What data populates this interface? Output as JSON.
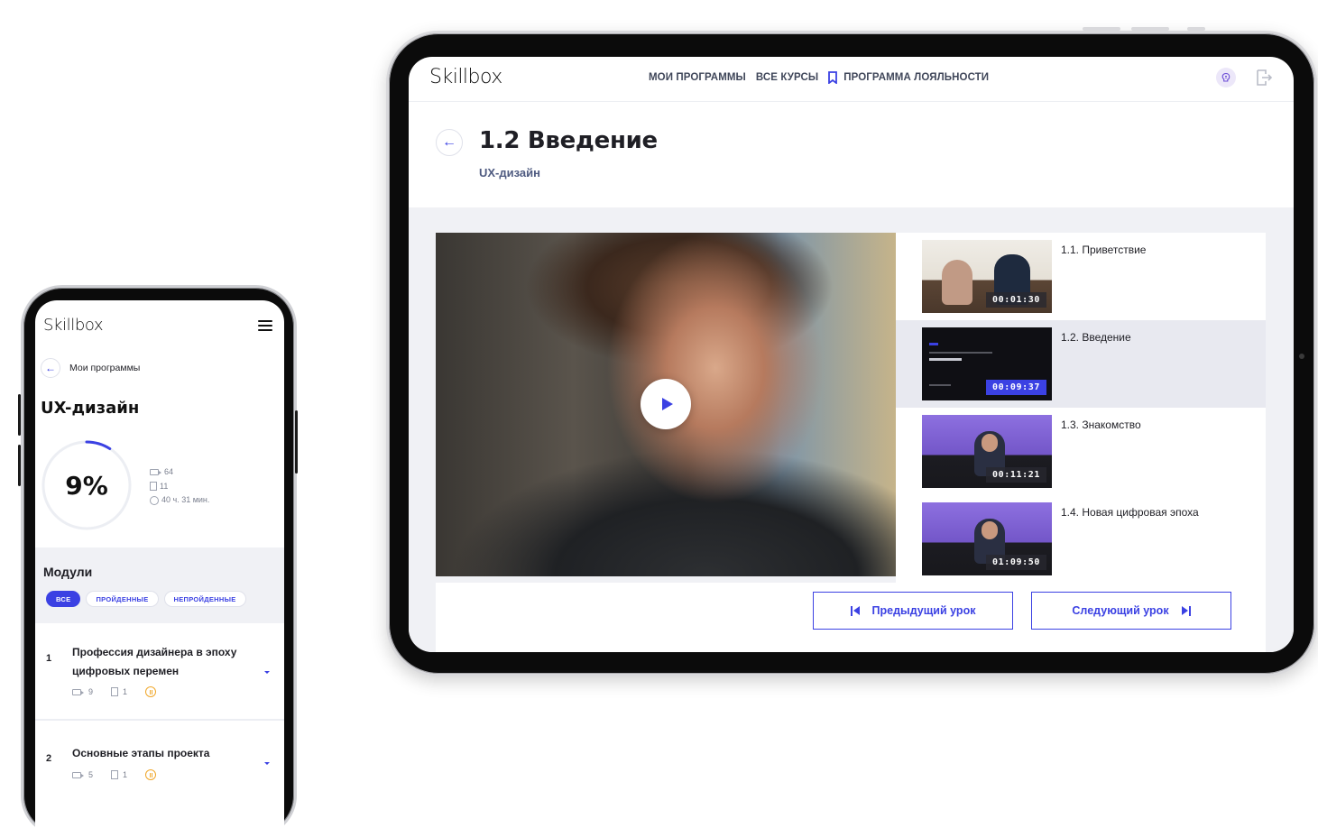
{
  "tablet": {
    "logo": "Skillbox",
    "nav": {
      "my_programs": "МОИ ПРОГРАММЫ",
      "all_courses": "ВСЕ КУРСЫ",
      "loyalty": "ПРОГРАММА ЛОЯЛЬНОСТИ"
    },
    "lesson": {
      "title": "1.2 Введение",
      "course": "UX-дизайн"
    },
    "playlist": [
      {
        "title": "1.1. Приветствие",
        "duration": "00:01:30",
        "active": false
      },
      {
        "title": "1.2. Введение",
        "duration": "00:09:37",
        "active": true
      },
      {
        "title": "1.3. Знакомство",
        "duration": "00:11:21",
        "active": false
      },
      {
        "title": "1.4. Новая цифровая эпоха",
        "duration": "01:09:50",
        "active": false
      }
    ],
    "buttons": {
      "prev": "Предыдущий урок",
      "next": "Следующий урок"
    },
    "colors": {
      "accent": "#3b41e3",
      "active_row": "#e8e9f0",
      "section_bg": "#f0f1f5"
    }
  },
  "phone": {
    "logo": "Skillbox",
    "back_label": "Мои программы",
    "course_title": "UX-дизайн",
    "progress": {
      "percent_label": "9%",
      "value": 0.09
    },
    "stats": {
      "videos": "64",
      "docs": "11",
      "time": "40 ч. 31 мин."
    },
    "modules_title": "Модули",
    "filters": [
      {
        "label": "ВСЕ",
        "active": true
      },
      {
        "label": "ПРОЙДЕННЫЕ",
        "active": false
      },
      {
        "label": "НЕПРОЙДЕННЫЕ",
        "active": false
      }
    ],
    "modules": [
      {
        "number": "1",
        "title": "Профессия дизайнера в эпоху цифровых перемен",
        "videos": "9",
        "docs": "1"
      },
      {
        "number": "2",
        "title": "Основные этапы проекта",
        "videos": "5",
        "docs": "1"
      }
    ]
  }
}
